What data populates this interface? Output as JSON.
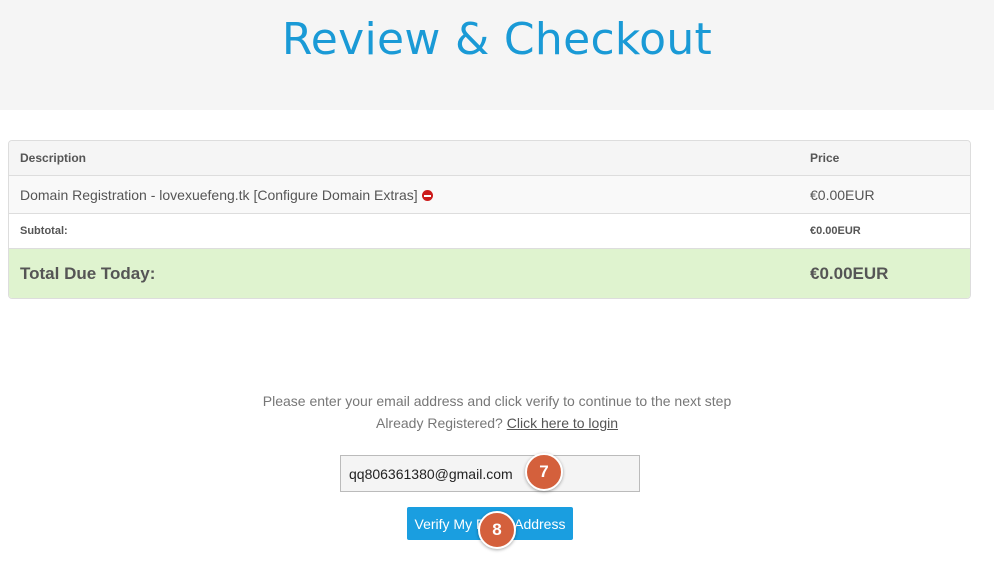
{
  "header": {
    "title": "Review & Checkout"
  },
  "cart": {
    "columns": {
      "description": "Description",
      "price": "Price"
    },
    "item": {
      "description": "Domain Registration - lovexuefeng.tk [Configure Domain Extras]",
      "price": "€0.00EUR",
      "remove_icon": "remove-icon"
    },
    "subtotal": {
      "label": "Subtotal:",
      "value": "€0.00EUR"
    },
    "total": {
      "label": "Total Due Today:",
      "value": "€0.00EUR"
    }
  },
  "verify": {
    "instructions": "Please enter your email address and click verify to continue to the next step",
    "already_registered": "Already Registered?",
    "login_link": "Click here to login",
    "email_value": "qq806361380@gmail.com",
    "button_label": "Verify My Email Address"
  },
  "annotations": {
    "step7": "7",
    "step8": "8"
  },
  "colors": {
    "accent": "#1a9ad6",
    "button": "#1a9ee0",
    "total_bg": "#dff3cf",
    "badge": "#d4603c",
    "remove": "#cc1a1a"
  }
}
